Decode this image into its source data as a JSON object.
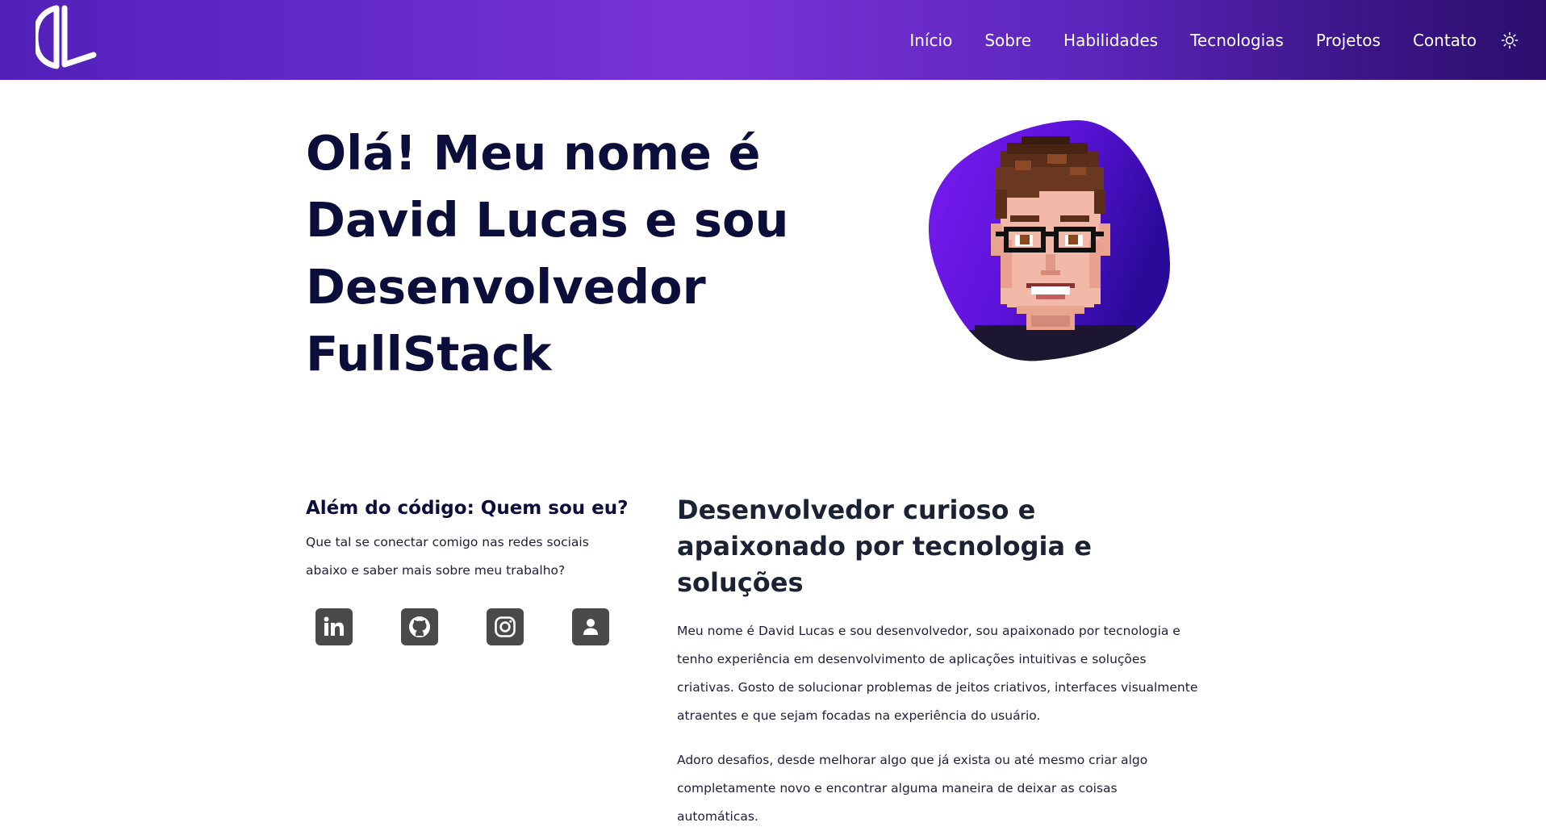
{
  "brand": {
    "logo_text": "DL",
    "accent": "#6a2ccf",
    "heading_color": "#0b0d3a"
  },
  "nav": {
    "items": [
      "Início",
      "Sobre",
      "Habilidades",
      "Tecnologias",
      "Projetos",
      "Contato"
    ],
    "theme_toggle_icon": "sun-icon"
  },
  "hero": {
    "title_lines": [
      "Olá! Meu nome é",
      "David Lucas e sou",
      "Desenvolvedor",
      "FullStack"
    ],
    "avatar_icon": "pixel-art-avatar"
  },
  "about": {
    "title": "Além do código: Quem sou eu?",
    "subtitle": "Que tal se conectar comigo nas redes sociais abaixo e saber mais sobre meu trabalho?",
    "socials": [
      "linkedin-icon",
      "github-icon",
      "instagram-icon",
      "user-icon"
    ]
  },
  "bio": {
    "heading": "Desenvolvedor curioso e apaixonado por tecnologia e soluções",
    "paragraphs": [
      "Meu nome é David Lucas e sou desenvolvedor, sou apaixonado por tecnologia e tenho experiência em desenvolvimento de aplicações intuitivas e soluções criativas. Gosto de solucionar problemas de jeitos criativos, interfaces visualmente atraentes e que sejam focadas na experiência do usuário.",
      "Adoro desafios, desde melhorar algo que já exista ou até mesmo criar algo completamente novo e encontrar alguma maneira de deixar as coisas automáticas."
    ]
  }
}
